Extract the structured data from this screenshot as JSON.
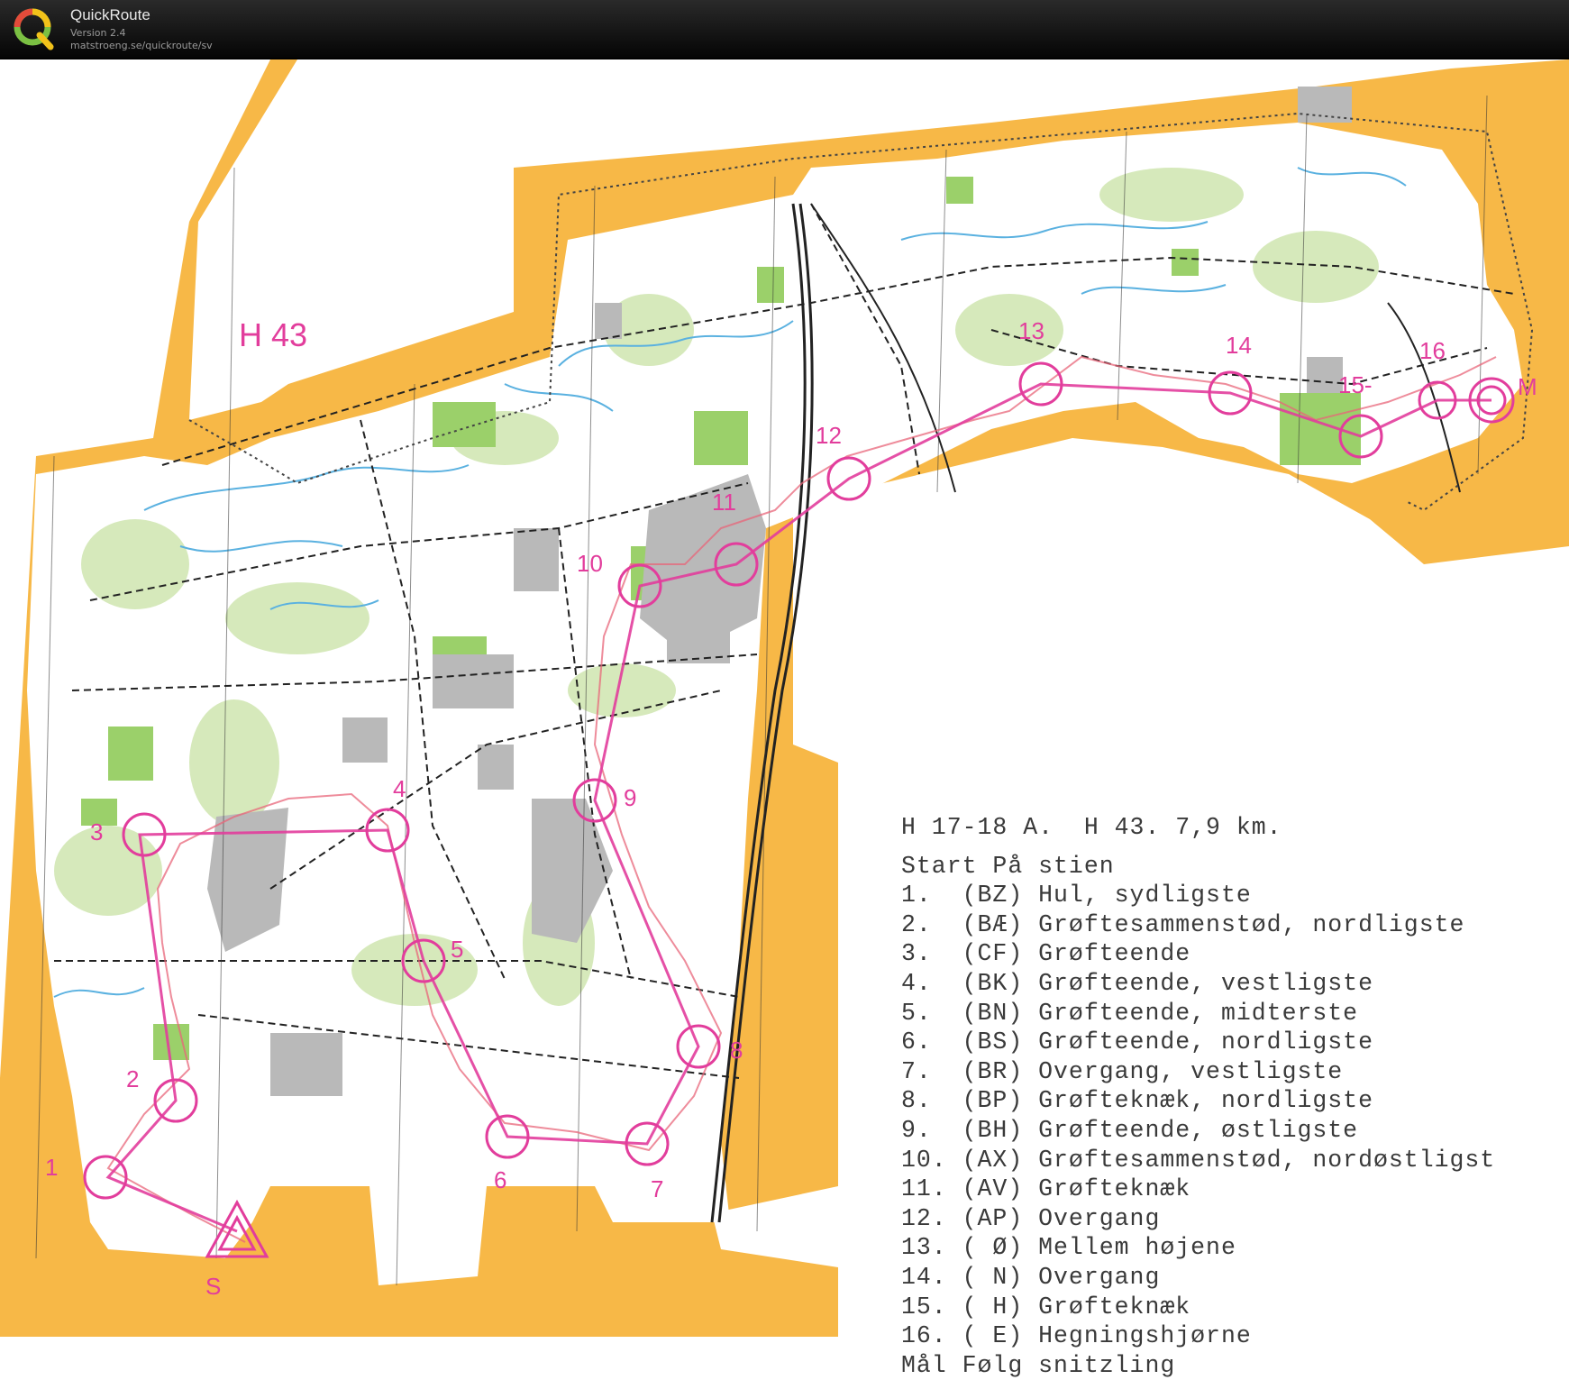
{
  "app": {
    "title": "QuickRoute",
    "version": "Version 2.4",
    "url": "matstroeng.se/quickroute/sv",
    "logo_letter": "Q"
  },
  "map": {
    "course_name": "H 43",
    "colors": {
      "open_land": "#f7b847",
      "rough_open": "#fde7a3",
      "green": "#9bd06a",
      "marsh": "#d2e7b4",
      "water": "#5ab1e0",
      "grey": "#b9b9b9",
      "course": "#e23d9c",
      "route": "#e8667a"
    },
    "controls": [
      {
        "label": "1"
      },
      {
        "label": "2"
      },
      {
        "label": "3"
      },
      {
        "label": "4"
      },
      {
        "label": "5"
      },
      {
        "label": "6"
      },
      {
        "label": "7"
      },
      {
        "label": "8"
      },
      {
        "label": "9"
      },
      {
        "label": "10"
      },
      {
        "label": "11"
      },
      {
        "label": "12"
      },
      {
        "label": "13"
      },
      {
        "label": "14"
      },
      {
        "label": "15-"
      },
      {
        "label": "16"
      },
      {
        "label": "M"
      },
      {
        "label": "S"
      }
    ]
  },
  "descriptions": {
    "header": "H 17-18 A.  H 43. 7,9 km.",
    "start": "Start På stien",
    "items": [
      "1.  (BZ) Hul, sydligste",
      "2.  (BÆ) Grøftesammenstød, nordligste",
      "3.  (CF) Grøfteende",
      "4.  (BK) Grøfteende, vestligste",
      "5.  (BN) Grøfteende, midterste",
      "6.  (BS) Grøfteende, nordligste",
      "7.  (BR) Overgang, vestligste",
      "8.  (BP) Grøfteknæk, nordligste",
      "9.  (BH) Grøfteende, østligste",
      "10. (AX) Grøftesammenstød, nordøstligst",
      "11. (AV) Grøfteknæk",
      "12. (AP) Overgang",
      "13. ( Ø) Mellem højene",
      "14. ( N) Overgang",
      "15. ( H) Grøfteknæk",
      "16. ( E) Hegningshjørne"
    ],
    "finish": "Mål Følg snitzling"
  }
}
